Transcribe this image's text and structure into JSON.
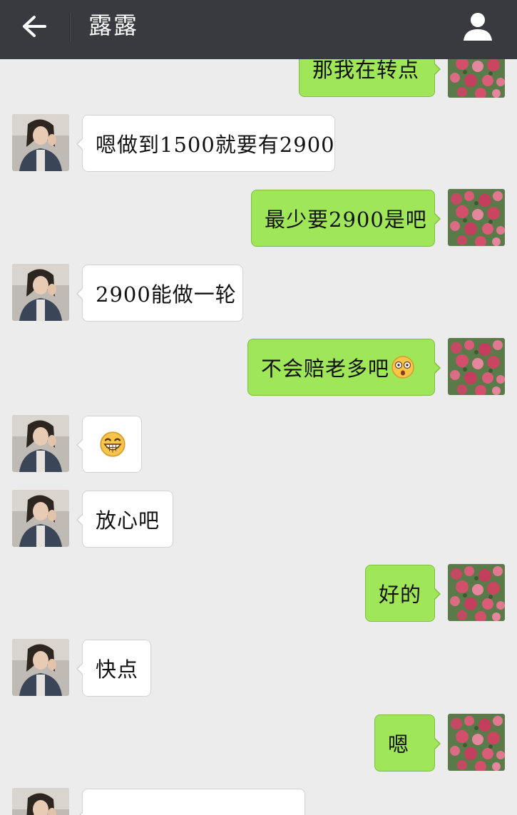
{
  "header": {
    "title": "露露",
    "back_icon": "arrow-left-icon",
    "profile_icon": "person-icon",
    "background": "#393a3f"
  },
  "colors": {
    "chat_background": "#ececec",
    "outgoing_bubble": "#9fe658",
    "incoming_bubble": "#ffffff"
  },
  "messages": [
    {
      "side": "out",
      "text": "那我在转点"
    },
    {
      "side": "in",
      "text": "嗯做到1500就要有2900"
    },
    {
      "side": "out",
      "text": "最少要2900是吧"
    },
    {
      "side": "in",
      "text": "2900能做一轮"
    },
    {
      "side": "out",
      "text": "不会赔老多吧",
      "emoji": "shocked-face-emoji"
    },
    {
      "side": "in",
      "text": "",
      "emoji": "grinning-face-emoji"
    },
    {
      "side": "in",
      "text": "放心吧"
    },
    {
      "side": "out",
      "text": "好的"
    },
    {
      "side": "in",
      "text": "快点"
    },
    {
      "side": "out",
      "text": "嗯"
    },
    {
      "side": "in",
      "text": ""
    }
  ]
}
